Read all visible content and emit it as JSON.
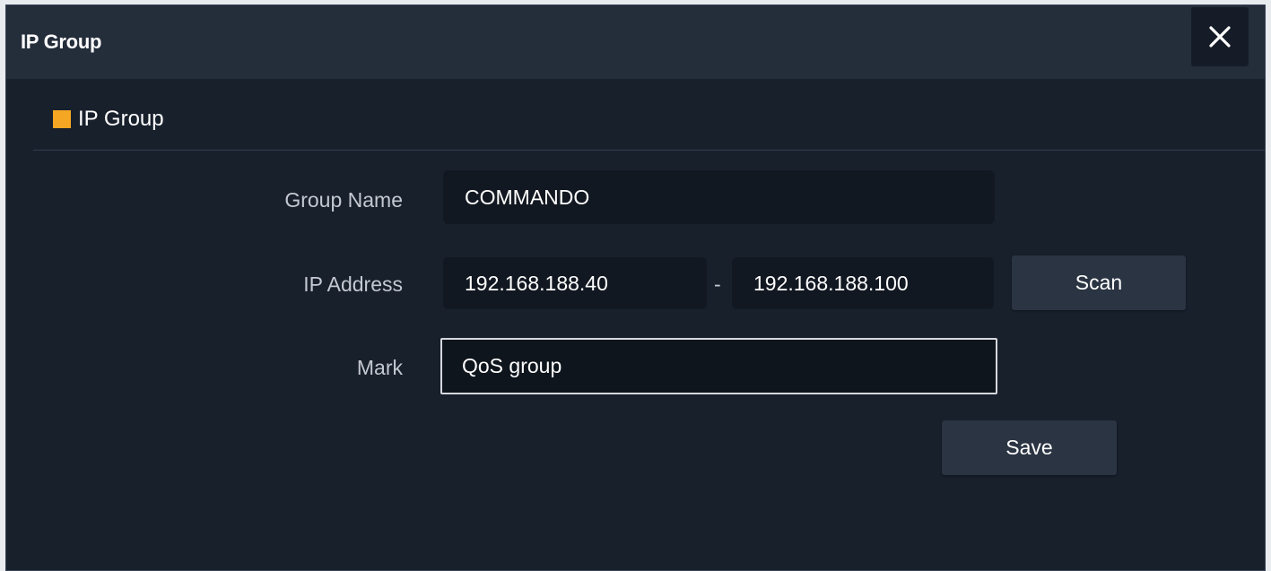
{
  "dialog": {
    "title": "IP Group",
    "close_icon": "close-icon"
  },
  "section": {
    "title": "IP Group",
    "marker_color": "#f5a623"
  },
  "form": {
    "group_name": {
      "label": "Group Name",
      "value": "COMMANDO"
    },
    "ip_address": {
      "label": "IP Address",
      "start_value": "192.168.188.40",
      "separator": "-",
      "end_value": "192.168.188.100"
    },
    "mark": {
      "label": "Mark",
      "value": "QoS group"
    },
    "scan_label": "Scan",
    "save_label": "Save"
  }
}
